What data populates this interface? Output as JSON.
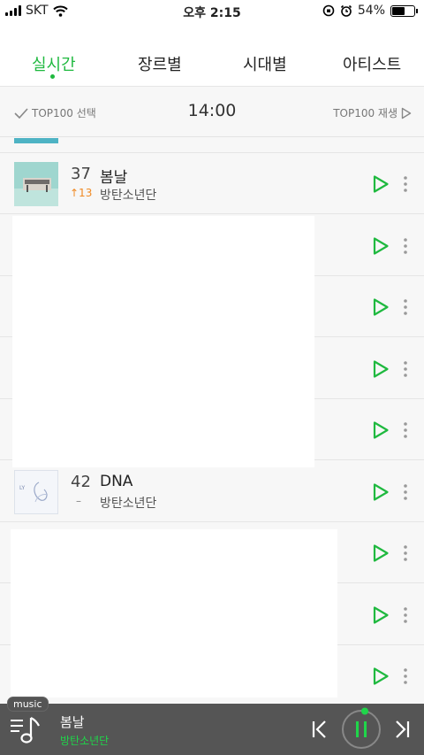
{
  "status_bar": {
    "carrier": "SKT",
    "time": "오후 2:15",
    "battery": "54%"
  },
  "tabs": [
    {
      "label": "실시간",
      "active": true
    },
    {
      "label": "장르별",
      "active": false
    },
    {
      "label": "시대별",
      "active": false
    },
    {
      "label": "아티스트",
      "active": false
    }
  ],
  "chart_header": {
    "select_label": "TOP100 선택",
    "time": "14:00",
    "play_all_label": "TOP100 재생"
  },
  "songs": [
    {
      "rank": "37",
      "change": "↑13",
      "title": "봄날",
      "artist": "방탄소년단"
    },
    {
      "rank": "42",
      "change": "–",
      "title": "DNA",
      "artist": "방탄소년단"
    }
  ],
  "player": {
    "badge": "music",
    "title": "봄날",
    "artist": "방탄소년단"
  },
  "colors": {
    "accent": "#1fb93f",
    "rank_up": "#f08a24",
    "player_bg": "#555555"
  }
}
